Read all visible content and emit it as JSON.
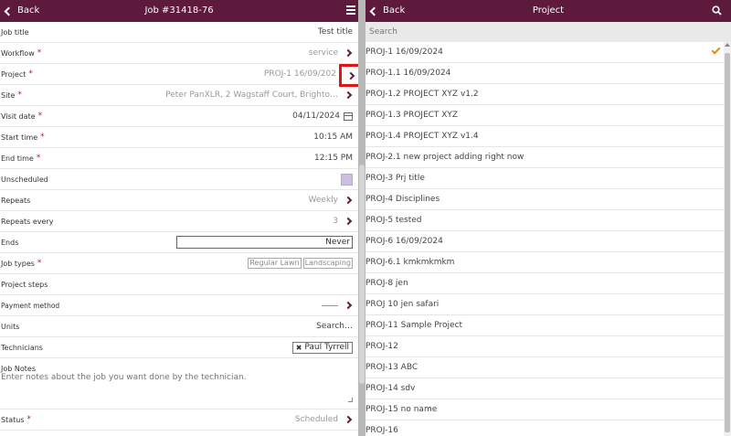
{
  "left": {
    "back_label": "Back",
    "title": "Job #31418-76",
    "fields": {
      "job_title": {
        "label": "Job title",
        "value": "Test title"
      },
      "workflow": {
        "label": "Workflow",
        "value": "service"
      },
      "project": {
        "label": "Project",
        "value": "PROJ-1 16/09/202"
      },
      "site": {
        "label": "Site",
        "value": "Peter PanXLR, 2 Wagstaff Court, Brighto…"
      },
      "visit_date": {
        "label": "Visit date",
        "value": "04/11/2024"
      },
      "start_time": {
        "label": "Start time",
        "value": "10:15 AM"
      },
      "end_time": {
        "label": "End time",
        "value": "12:15 PM"
      },
      "unscheduled": {
        "label": "Unscheduled"
      },
      "repeats": {
        "label": "Repeats",
        "value": "Weekly"
      },
      "repeats_every": {
        "label": "Repeats every",
        "value": "3"
      },
      "ends": {
        "label": "Ends",
        "value": "Never"
      },
      "job_types": {
        "label": "Job types",
        "chips": [
          "Regular Lawn",
          "Landscaping"
        ]
      },
      "project_steps": {
        "label": "Project steps"
      },
      "payment_method": {
        "label": "Payment method"
      },
      "units": {
        "label": "Units",
        "value": "Search…"
      },
      "technicians": {
        "label": "Technicians",
        "chip": "Paul Tyrrell"
      },
      "job_notes": {
        "label": "Job Notes",
        "placeholder": "Enter notes about the job you want done by the technician."
      },
      "status": {
        "label": "Status",
        "value": "Scheduled"
      }
    },
    "required_mark": "*"
  },
  "right": {
    "back_label": "Back",
    "title": "Project",
    "search_placeholder": "Search",
    "projects": [
      "PROJ-1 16/09/2024",
      "PROJ-1.1 16/09/2024",
      "PROJ-1.2 PROJECT XYZ v1.2",
      "PROJ-1.3 PROJECT XYZ",
      "PROJ-1.4 PROJECT XYZ v1.4",
      "PROJ-2.1 new project adding right now",
      "PROJ-3 Prj title",
      "PROJ-4 Disciplines",
      "PROJ-5 tested",
      "PROJ-6 16/09/2024",
      "PROJ-6.1 kmkmkmkm",
      "PROJ-8 jen",
      "PROJ 10 jen safari",
      "PROJ-11 Sample Project",
      "PROJ-12",
      "PROJ-13 ABC",
      "PROJ-14 sdv",
      "PROJ-15 no name",
      "PROJ-16"
    ],
    "selected_index": 0
  },
  "colors": {
    "header_bg": "#5e1a3c",
    "accent": "#5e1a3c",
    "required": "#c0143c",
    "check": "#e08a1c",
    "highlight_box": "#e01515"
  }
}
